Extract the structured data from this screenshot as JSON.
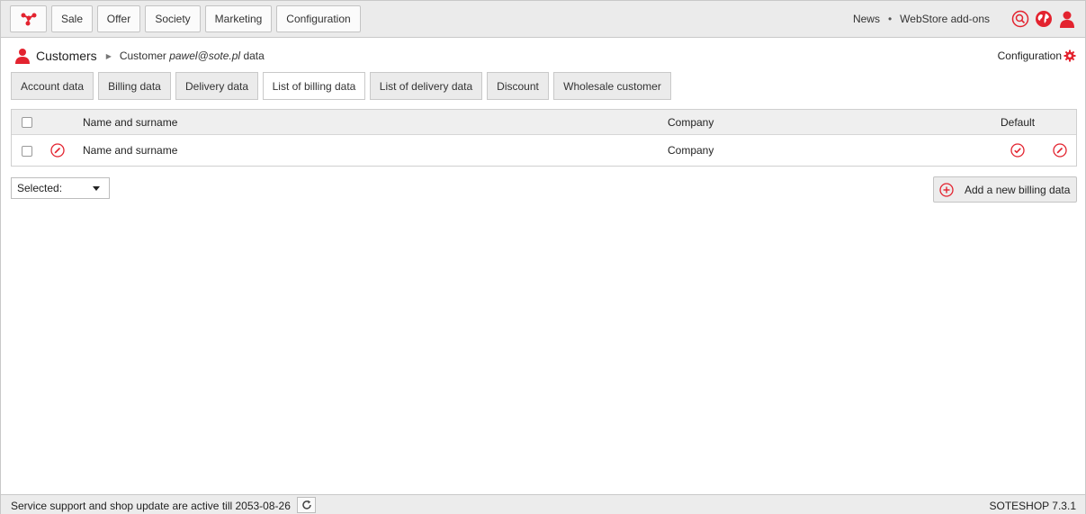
{
  "topnav": {
    "items": [
      "Sale",
      "Offer",
      "Society",
      "Marketing",
      "Configuration"
    ],
    "news": "News",
    "separator": "•",
    "webstore": "WebStore add-ons"
  },
  "header": {
    "title": "Customers",
    "sub_prefix": "Customer",
    "sub_email": "pawel@sote.pl",
    "sub_suffix": "data",
    "config": "Configuration"
  },
  "tabs": [
    "Account data",
    "Billing data",
    "Delivery data",
    "List of billing data",
    "List of delivery data",
    "Discount",
    "Wholesale customer"
  ],
  "active_tab": "List of billing data",
  "table": {
    "headers": {
      "name": "Name and surname",
      "company": "Company",
      "default": "Default"
    },
    "rows": [
      {
        "name": "Name and surname",
        "company": "Company"
      }
    ]
  },
  "actions": {
    "selected": "Selected:",
    "add": "Add a new billing data"
  },
  "footer": {
    "support": "Service support and shop update are active till 2053-08-26",
    "version": "SOTESHOP 7.3.1"
  },
  "colors": {
    "accent": "#e3232f",
    "topbar": "#ebebeb"
  }
}
